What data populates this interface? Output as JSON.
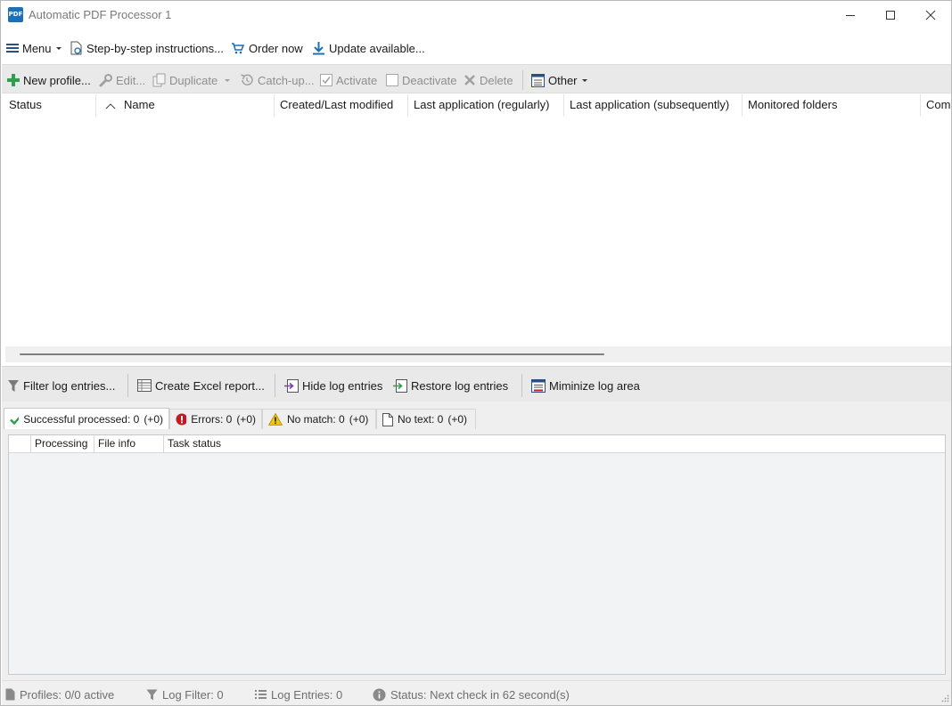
{
  "window": {
    "app_icon_text": "PDF",
    "title": "Automatic PDF Processor 1"
  },
  "menubar": {
    "menu": "Menu",
    "instructions": "Step-by-step instructions...",
    "order": "Order now",
    "update": "Update available..."
  },
  "toolbar": {
    "new_profile": "New profile...",
    "edit": "Edit...",
    "duplicate": "Duplicate",
    "catch_up": "Catch-up...",
    "activate": "Activate",
    "deactivate": "Deactivate",
    "delete": "Delete",
    "other": "Other"
  },
  "profiles_grid": {
    "columns": [
      "Status",
      "Name",
      "Created/Last modified",
      "Last application (regularly)",
      "Last application (subsequently)",
      "Monitored folders",
      "Com"
    ]
  },
  "log_toolbar": {
    "filter": "Filter log entries...",
    "excel": "Create Excel report...",
    "hide": "Hide log entries",
    "restore": "Restore log entries",
    "minimize": "Miminize log area"
  },
  "log_tabs": [
    {
      "label": "Successful processed: 0",
      "delta": "(+0)"
    },
    {
      "label": "Errors: 0",
      "delta": "(+0)"
    },
    {
      "label": "No match: 0",
      "delta": "(+0)"
    },
    {
      "label": "No text: 0",
      "delta": "(+0)"
    }
  ],
  "log_grid": {
    "columns": [
      "Processing",
      "File info",
      "Task status"
    ]
  },
  "statusbar": {
    "profiles": "Profiles: 0/0 active",
    "log_filter": "Log Filter: 0",
    "log_entries": "Log Entries: 0",
    "status": "Status: Next check in 62 second(s)"
  },
  "colors": {
    "accent_blue": "#1f6fb6",
    "green_plus": "#2e9e4f",
    "error_red": "#c6191f",
    "warning_yellow": "#f2c21b",
    "toolbar_bg": "#e9e9e9"
  }
}
